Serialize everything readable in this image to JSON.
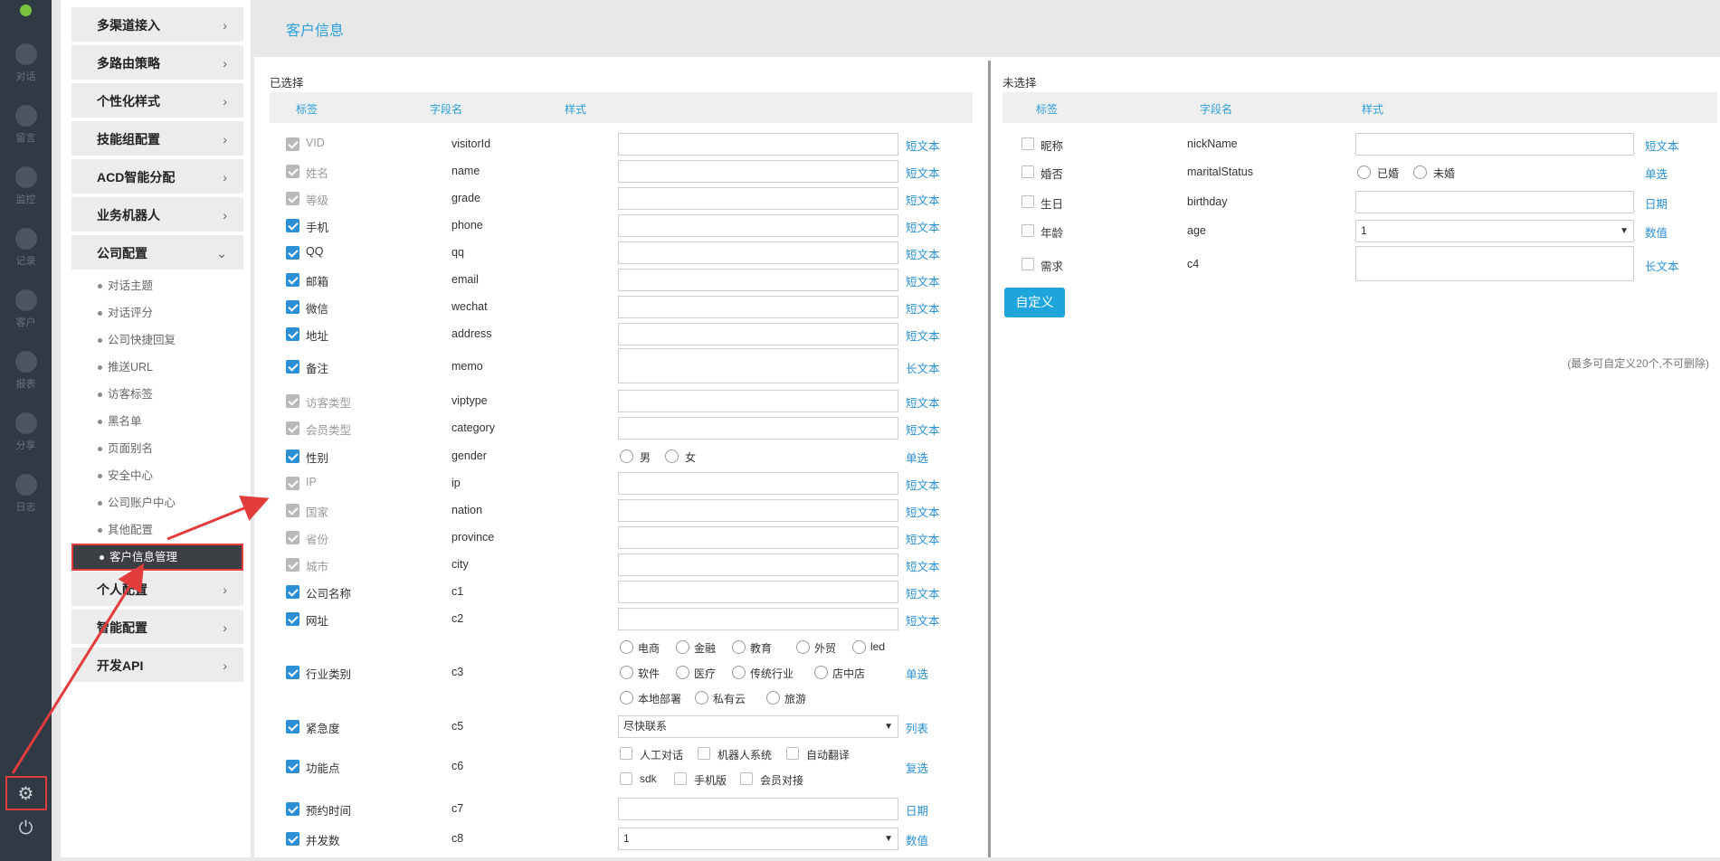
{
  "rail": {
    "items": [
      {
        "label": "对话",
        "icon": "chat-icon"
      },
      {
        "label": "留言",
        "icon": "mail-icon"
      },
      {
        "label": "监控",
        "icon": "eye-icon"
      },
      {
        "label": "记录",
        "icon": "clock-icon"
      },
      {
        "label": "客户",
        "icon": "contact-card-icon"
      },
      {
        "label": "报表",
        "icon": "pie-chart-icon"
      },
      {
        "label": "分享",
        "icon": "share-icon"
      },
      {
        "label": "日志",
        "icon": "clipboard-icon"
      }
    ],
    "bottom": [
      {
        "icon": "gear-icon",
        "glyph": "⚙"
      },
      {
        "icon": "power-icon",
        "glyph": "⏻"
      }
    ]
  },
  "menu": {
    "heads": [
      {
        "label": "多渠道接入",
        "chev": "›"
      },
      {
        "label": "多路由策略",
        "chev": "›"
      },
      {
        "label": "个性化样式",
        "chev": "›"
      },
      {
        "label": "技能组配置",
        "chev": "›"
      },
      {
        "label": "ACD智能分配",
        "chev": "›"
      },
      {
        "label": "业务机器人",
        "chev": "›"
      },
      {
        "label": "公司配置",
        "chev": "⌄"
      }
    ],
    "subs": [
      "对话主题",
      "对话评分",
      "公司快捷回复",
      "推送URL",
      "访客标签",
      "黑名单",
      "页面别名",
      "安全中心",
      "公司账户中心",
      "其他配置",
      "客户信息管理"
    ],
    "tail": [
      {
        "label": "个人配置",
        "chev": "›"
      },
      {
        "label": "智能配置",
        "chev": "›"
      },
      {
        "label": "开发API",
        "chev": "›"
      }
    ]
  },
  "header": {
    "title": "客户信息"
  },
  "selected": {
    "title": "已选择",
    "cols": {
      "label": "标签",
      "field": "字段名",
      "style": "样式"
    },
    "rows": [
      {
        "label": "VID",
        "field": "visitorId",
        "style": "短文本",
        "state": "dis"
      },
      {
        "label": "姓名",
        "field": "name",
        "style": "短文本",
        "state": "dis"
      },
      {
        "label": "等级",
        "field": "grade",
        "style": "短文本",
        "state": "dis"
      },
      {
        "label": "手机",
        "field": "phone",
        "style": "短文本",
        "state": "on"
      },
      {
        "label": "QQ",
        "field": "qq",
        "style": "短文本",
        "state": "on"
      },
      {
        "label": "邮箱",
        "field": "email",
        "style": "短文本",
        "state": "on"
      },
      {
        "label": "微信",
        "field": "wechat",
        "style": "短文本",
        "state": "on"
      },
      {
        "label": "地址",
        "field": "address",
        "style": "短文本",
        "state": "on"
      },
      {
        "label": "备注",
        "field": "memo",
        "style": "长文本",
        "state": "on"
      },
      {
        "label": "访客类型",
        "field": "viptype",
        "style": "短文本",
        "state": "dis"
      },
      {
        "label": "会员类型",
        "field": "category",
        "style": "短文本",
        "state": "dis"
      },
      {
        "label": "性别",
        "field": "gender",
        "style": "单选",
        "state": "on",
        "options": [
          "男",
          "女"
        ]
      },
      {
        "label": "IP",
        "field": "ip",
        "style": "短文本",
        "state": "dis"
      },
      {
        "label": "国家",
        "field": "nation",
        "style": "短文本",
        "state": "dis"
      },
      {
        "label": "省份",
        "field": "province",
        "style": "短文本",
        "state": "dis"
      },
      {
        "label": "城市",
        "field": "city",
        "style": "短文本",
        "state": "dis"
      },
      {
        "label": "公司名称",
        "field": "c1",
        "style": "短文本",
        "state": "on"
      },
      {
        "label": "网址",
        "field": "c2",
        "style": "短文本",
        "state": "on"
      },
      {
        "label": "行业类别",
        "field": "c3",
        "style": "单选",
        "state": "on",
        "options": [
          "电商",
          "金融",
          "教育",
          "外贸",
          "led",
          "软件",
          "医疗",
          "传统行业",
          "店中店",
          "本地部署",
          "私有云",
          "旅游"
        ]
      },
      {
        "label": "紧急度",
        "field": "c5",
        "style": "列表",
        "state": "on",
        "select": "尽快联系"
      },
      {
        "label": "功能点",
        "field": "c6",
        "style": "复选",
        "state": "on",
        "options": [
          "人工对话",
          "机器人系统",
          "自动翻译",
          "sdk",
          "手机版",
          "会员对接"
        ]
      },
      {
        "label": "预约时间",
        "field": "c7",
        "style": "日期",
        "state": "on"
      },
      {
        "label": "并发数",
        "field": "c8",
        "style": "数值",
        "state": "on",
        "select": "1"
      }
    ]
  },
  "unselected": {
    "title": "未选择",
    "cols": {
      "label": "标签",
      "field": "字段名",
      "style": "样式"
    },
    "rows": [
      {
        "label": "昵称",
        "field": "nickName",
        "style": "短文本"
      },
      {
        "label": "婚否",
        "field": "maritalStatus",
        "style": "单选",
        "options": [
          "已婚",
          "未婚"
        ]
      },
      {
        "label": "生日",
        "field": "birthday",
        "style": "日期"
      },
      {
        "label": "年龄",
        "field": "age",
        "style": "数值",
        "select": "1"
      },
      {
        "label": "需求",
        "field": "c4",
        "style": "长文本"
      }
    ],
    "custom_button": "自定义",
    "note": "(最多可自定义20个,不可删除)"
  },
  "colors": {
    "accent": "#2a8fd4",
    "rail": "#2f3a44",
    "annotation": "#e23c3c"
  }
}
